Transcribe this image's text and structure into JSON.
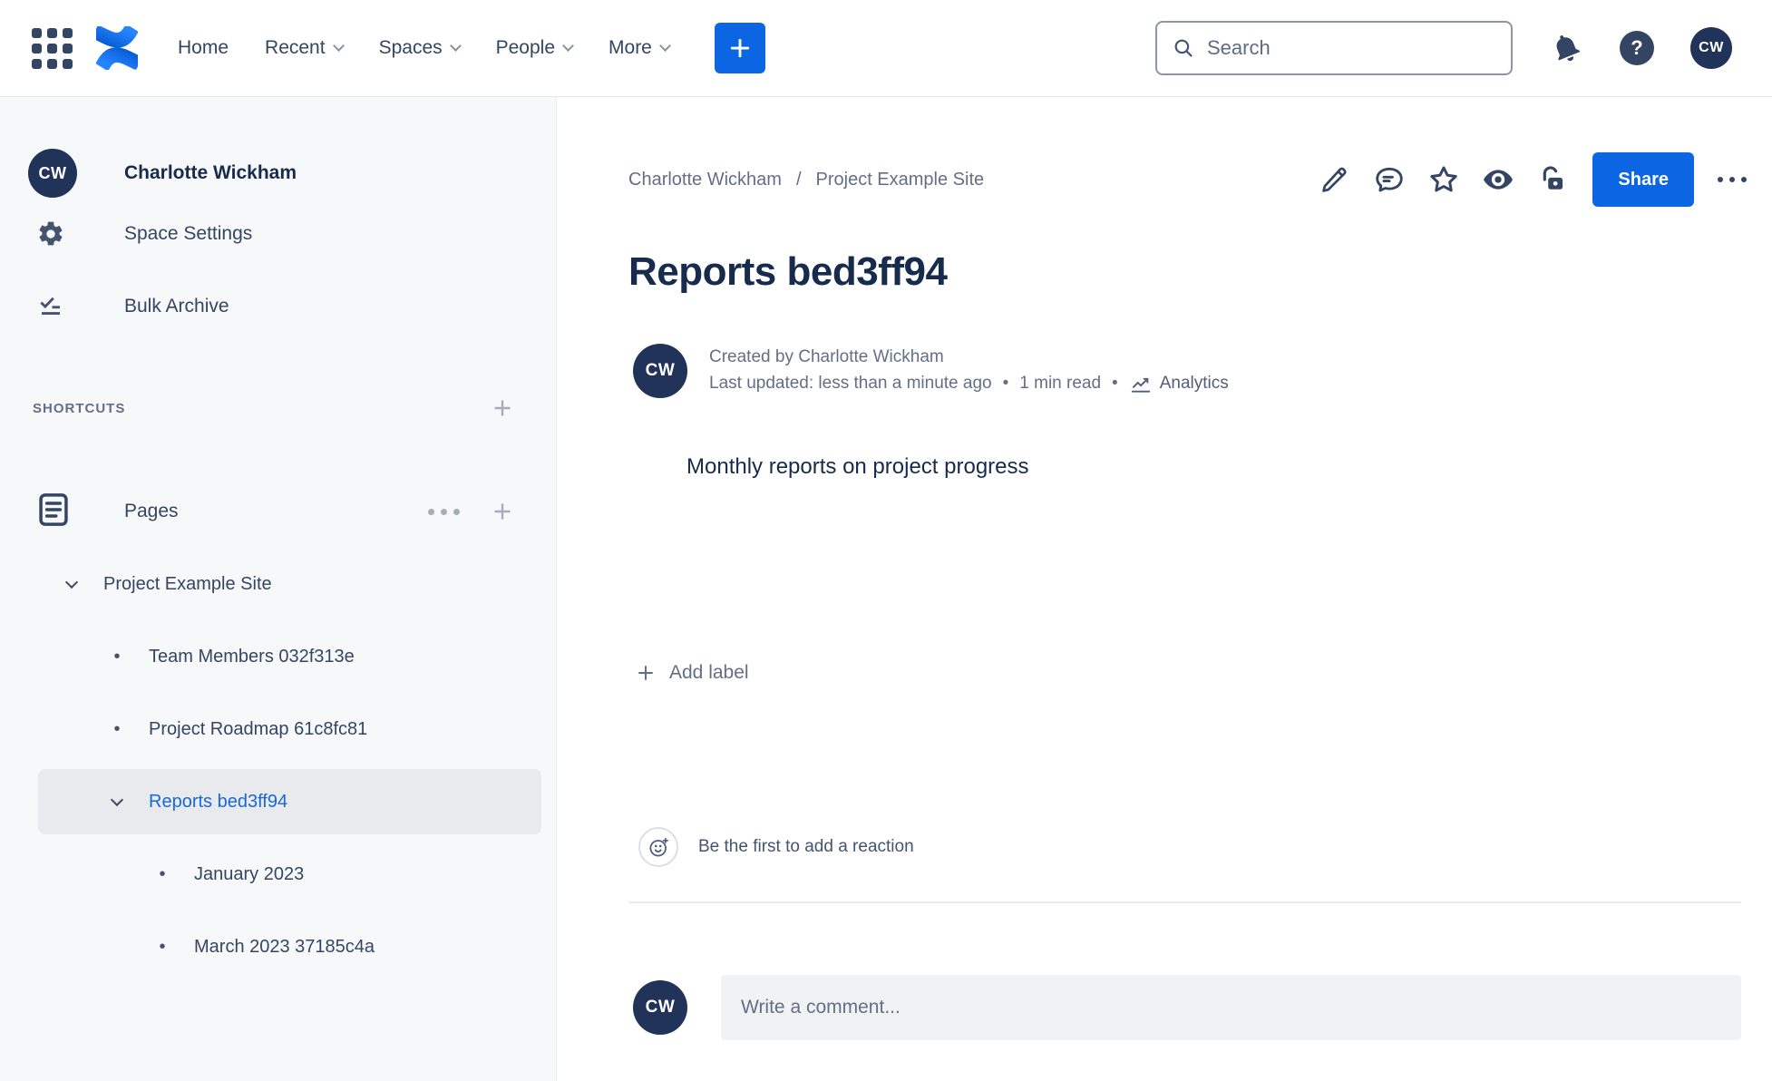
{
  "topbar": {
    "nav": [
      {
        "label": "Home",
        "dropdown": false
      },
      {
        "label": "Recent",
        "dropdown": true
      },
      {
        "label": "Spaces",
        "dropdown": true
      },
      {
        "label": "People",
        "dropdown": true
      },
      {
        "label": "More",
        "dropdown": true
      }
    ],
    "search_placeholder": "Search",
    "help_glyph": "?",
    "avatar_initials": "CW"
  },
  "sidebar": {
    "avatar_initials": "CW",
    "space_name": "Charlotte Wickham",
    "items": [
      {
        "icon": "gear-icon",
        "label": "Space Settings"
      },
      {
        "icon": "bulk-archive-icon",
        "label": "Bulk Archive"
      }
    ],
    "shortcuts_heading": "SHORTCUTS",
    "pages_label": "Pages",
    "bullet_char": "•",
    "tree": [
      {
        "label": "Project Example Site",
        "level": 1,
        "marker": "chevron",
        "selected": false
      },
      {
        "label": "Team Members 032f313e",
        "level": 2,
        "marker": "bullet",
        "selected": false
      },
      {
        "label": "Project Roadmap 61c8fc81",
        "level": 2,
        "marker": "bullet",
        "selected": false
      },
      {
        "label": "Reports bed3ff94",
        "level": 2,
        "marker": "chevron",
        "selected": true
      },
      {
        "label": "January 2023",
        "level": 3,
        "marker": "bullet",
        "selected": false
      },
      {
        "label": "March 2023 37185c4a",
        "level": 3,
        "marker": "bullet",
        "selected": false
      }
    ]
  },
  "content": {
    "breadcrumb": [
      "Charlotte Wickham",
      "Project Example Site"
    ],
    "breadcrumb_separator": "/",
    "share_label": "Share",
    "title": "Reports bed3ff94",
    "byline": {
      "avatar_initials": "CW",
      "created": "Created by Charlotte Wickham",
      "updated": "Last updated: less than a minute ago",
      "dot": "•",
      "read_time": "1 min read",
      "analytics_label": "Analytics"
    },
    "body_text": "Monthly reports on project progress",
    "add_label": "Add label",
    "reaction_prompt": "Be the first to add a reaction",
    "comment": {
      "avatar_initials": "CW",
      "placeholder": "Write a comment..."
    }
  },
  "colors": {
    "brand_blue": "#0C66E4",
    "link_blue": "#1868DB",
    "navy_text": "#172B4D",
    "gray_text": "#626F86",
    "sidebar_bg": "#F7F8FA",
    "selected_row_bg": "#E8EAED",
    "avatar_navy": "#22335A"
  }
}
